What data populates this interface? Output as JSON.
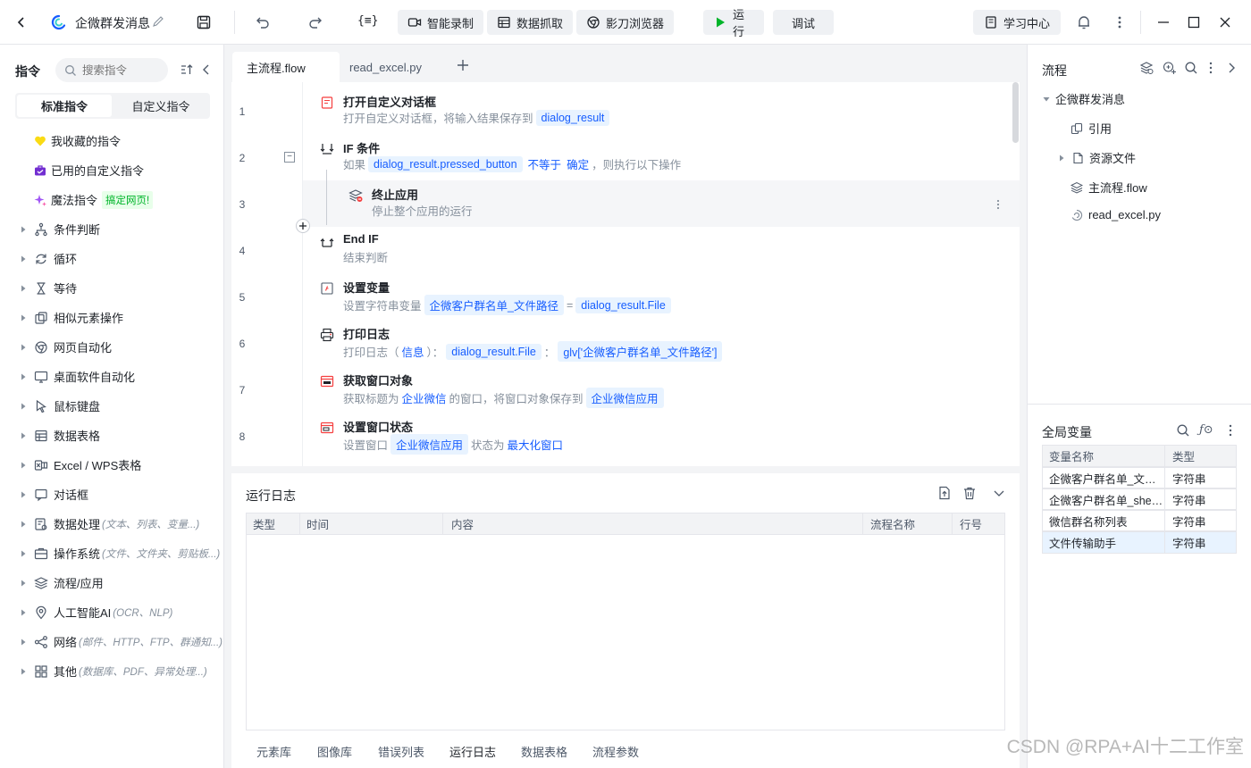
{
  "titlebar": {
    "project_name": "企微群发消息",
    "smart_record": "智能录制",
    "data_capture": "数据抓取",
    "shadow_browser": "影刀浏览器",
    "run": "运行",
    "debug": "调试",
    "learn_center": "学习中心"
  },
  "left": {
    "title": "指令",
    "search_placeholder": "搜索指令",
    "tabs": [
      "标准指令",
      "自定义指令"
    ],
    "special": [
      {
        "label": "我收藏的指令",
        "icon": "heart-icon"
      },
      {
        "label": "已用的自定义指令",
        "icon": "briefcase-icon"
      },
      {
        "label": "魔法指令",
        "icon": "sparkle-icon",
        "badge": "搞定网页!"
      }
    ],
    "categories": [
      {
        "label": "条件判断",
        "sub": "",
        "icon": "branch-icon"
      },
      {
        "label": "循环",
        "sub": "",
        "icon": "loop-icon"
      },
      {
        "label": "等待",
        "sub": "",
        "icon": "hourglass-icon"
      },
      {
        "label": "相似元素操作",
        "sub": "",
        "icon": "copy-icon"
      },
      {
        "label": "网页自动化",
        "sub": "",
        "icon": "chrome-icon"
      },
      {
        "label": "桌面软件自动化",
        "sub": "",
        "icon": "monitor-icon"
      },
      {
        "label": "鼠标键盘",
        "sub": "",
        "icon": "cursor-icon"
      },
      {
        "label": "数据表格",
        "sub": "",
        "icon": "table-icon"
      },
      {
        "label": "Excel / WPS表格",
        "sub": "",
        "icon": "excel-icon"
      },
      {
        "label": "对话框",
        "sub": "",
        "icon": "dialog-icon"
      },
      {
        "label": "数据处理",
        "sub": "(文本、列表、变量...)",
        "icon": "data-process-icon"
      },
      {
        "label": "操作系统",
        "sub": "(文件、文件夹、剪贴板...)",
        "icon": "os-icon"
      },
      {
        "label": "流程/应用",
        "sub": "",
        "icon": "layers-icon"
      },
      {
        "label": "人工智能AI",
        "sub": "(OCR、NLP)",
        "icon": "ai-icon"
      },
      {
        "label": "网络",
        "sub": "(邮件、HTTP、FTP、群通知...)",
        "icon": "network-icon"
      },
      {
        "label": "其他",
        "sub": "(数据库、PDF、异常处理...)",
        "icon": "grid-icon"
      }
    ]
  },
  "editor": {
    "tabs": [
      "主流程.flow",
      "read_excel.py"
    ],
    "steps": [
      {
        "num": "1",
        "title": "打开自定义对话框",
        "desc_a": "打开自定义对话框，将输入结果保存到",
        "chip_a": "dialog_result"
      },
      {
        "num": "2",
        "title": "IF 条件",
        "desc_a": "如果",
        "chip_a": "dialog_result.pressed_button",
        "kw_a": "不等于",
        "kw_b": "确定",
        "desc_b": "，则执行以下操作"
      },
      {
        "num": "3",
        "title": "终止应用",
        "desc_a": "停止整个应用的运行"
      },
      {
        "num": "4",
        "title": "End IF",
        "desc_a": "结束判断"
      },
      {
        "num": "5",
        "title": "设置变量",
        "desc_a": "设置字符串变量",
        "chip_a": "企微客户群名单_文件路径",
        "desc_b": "=",
        "chip_b": "dialog_result.File"
      },
      {
        "num": "6",
        "title": "打印日志",
        "desc_a": "打印日志（",
        "kw_a": "信息",
        "desc_b": "）：",
        "chip_a": "dialog_result.File",
        "desc_c": "：",
        "chip_b": "glv['企微客户群名单_文件路径']"
      },
      {
        "num": "7",
        "title": "获取窗口对象",
        "desc_a": "获取标题为",
        "kw_a": "企业微信",
        "desc_b": "的窗口，将窗口对象保存到",
        "chip_a": "企业微信应用"
      },
      {
        "num": "8",
        "title": "设置窗口状态",
        "desc_a": "设置窗口",
        "chip_a": "企业微信应用",
        "desc_b": "状态为",
        "kw_a": "最大化窗口"
      }
    ]
  },
  "log": {
    "title": "运行日志",
    "columns": [
      "类型",
      "时间",
      "内容",
      "流程名称",
      "行号"
    ],
    "bottom_tabs": [
      "元素库",
      "图像库",
      "错误列表",
      "运行日志",
      "数据表格",
      "流程参数"
    ]
  },
  "right": {
    "flow_title": "流程",
    "tree_root": "企微群发消息",
    "tree_items": [
      "引用",
      "资源文件",
      "主流程.flow",
      "read_excel.py"
    ],
    "vars_title": "全局变量",
    "var_columns": [
      "变量名称",
      "类型"
    ],
    "vars": [
      {
        "name": "企微客户群名单_文件路径",
        "type": "字符串"
      },
      {
        "name": "企微客户群名单_sheet名",
        "type": "字符串"
      },
      {
        "name": "微信群名称列表",
        "type": "字符串"
      },
      {
        "name": "文件传输助手",
        "type": "字符串"
      }
    ]
  },
  "watermark": "CSDN @RPA+AI十二工作室",
  "colors": {
    "accent": "#165dff",
    "chip_bg": "#e8f3ff",
    "run_green": "#00b42a"
  }
}
